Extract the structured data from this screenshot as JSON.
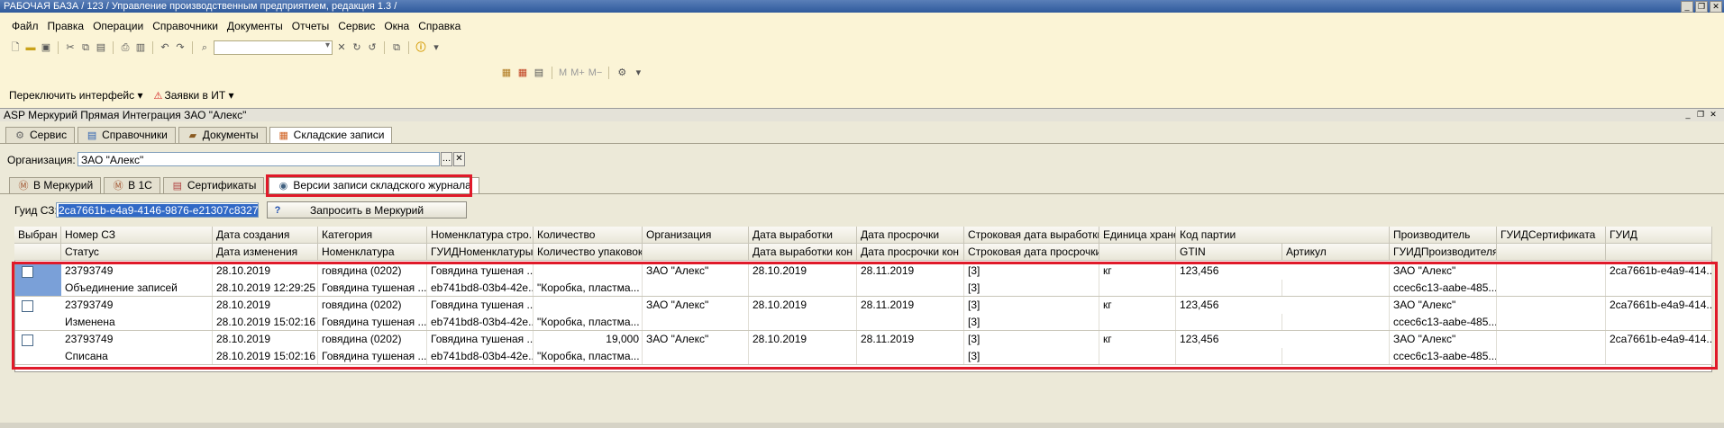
{
  "window": {
    "title": "РАБОЧАЯ БАЗА / 123 / Управление производственным предприятием, редакция 1.3 /"
  },
  "menu": [
    "Файл",
    "Правка",
    "Операции",
    "Справочники",
    "Документы",
    "Отчеты",
    "Сервис",
    "Окна",
    "Справка"
  ],
  "toolbar3": {
    "switch_label": "Переключить интерфейс",
    "requests_label": "Заявки в ИТ"
  },
  "subwindow": {
    "title": "ASP Меркурий Прямая Интеграция ЗАО \"Алекс\""
  },
  "main_tabs": [
    "Сервис",
    "Справочники",
    "Документы",
    "Складские записи"
  ],
  "org": {
    "label": "Организация:",
    "value": "ЗАО \"Алекс\""
  },
  "sub_tabs": [
    "В Меркурий",
    "В 1С",
    "Сертификаты",
    "Версии записи складского журнала"
  ],
  "guid": {
    "label": "Гуид СЗ:",
    "value": "2ca7661b-e4a9-4146-9876-e21307c8327f"
  },
  "request_button": "Запросить в Меркурий",
  "grid": {
    "header_top": [
      "Выбран",
      "Номер СЗ",
      "Дата создания",
      "Категория",
      "Номенклатура стро...",
      "Количество",
      "Организация",
      "Дата выработки",
      "Дата просрочки",
      "Строковая дата выработки",
      "Единица хранения",
      "Код партии",
      "Производитель",
      "ГУИДСертификата",
      "ГУИД"
    ],
    "header_bottom": [
      "",
      "Статус",
      "Дата изменения",
      "Номенклатура",
      "ГУИДНоменклатуры",
      "Количество упаковок",
      "",
      "Дата выработки кон",
      "Дата просрочки кон",
      "Строковая дата просрочки",
      "",
      "GTIN",
      "Артикул",
      "ГУИДПроизводителя",
      "",
      ""
    ],
    "rows": [
      {
        "top": [
          "23793749",
          "28.10.2019",
          "говядина (0202)",
          "Говядина тушеная ...",
          "",
          "ЗАО \"Алекс\"",
          "28.10.2019",
          "28.11.2019",
          "[3]",
          "кг",
          "123,456",
          "ЗАО \"Алекс\"",
          "",
          "2ca7661b-e4a9-414..."
        ],
        "bottom": [
          "Объединение записей",
          "28.10.2019 12:29:25",
          "Говядина тушеная ...",
          "eb741bd8-03b4-42e...",
          "\"Коробка, пластма...",
          "",
          "",
          "",
          "[3]",
          "",
          "",
          "",
          "ccec6c13-aabe-485...",
          "",
          ""
        ]
      },
      {
        "top": [
          "23793749",
          "28.10.2019",
          "говядина (0202)",
          "Говядина тушеная ...",
          "",
          "ЗАО \"Алекс\"",
          "28.10.2019",
          "28.11.2019",
          "[3]",
          "кг",
          "123,456",
          "ЗАО \"Алекс\"",
          "",
          "2ca7661b-e4a9-414..."
        ],
        "bottom": [
          "Изменена",
          "28.10.2019 15:02:16",
          "Говядина тушеная ...",
          "eb741bd8-03b4-42e...",
          "\"Коробка, пластма...",
          "",
          "",
          "",
          "[3]",
          "",
          "",
          "",
          "ccec6c13-aabe-485...",
          "",
          ""
        ]
      },
      {
        "top": [
          "23793749",
          "28.10.2019",
          "говядина (0202)",
          "Говядина тушеная ...",
          "19,000",
          "ЗАО \"Алекс\"",
          "28.10.2019",
          "28.11.2019",
          "[3]",
          "кг",
          "123,456",
          "ЗАО \"Алекс\"",
          "",
          "2ca7661b-e4a9-414..."
        ],
        "bottom": [
          "Списана",
          "28.10.2019 15:02:16",
          "Говядина тушеная ...",
          "eb741bd8-03b4-42e...",
          "\"Коробка, пластма...",
          "",
          "",
          "",
          "[3]",
          "",
          "",
          "",
          "ccec6c13-aabe-485...",
          "",
          ""
        ]
      }
    ]
  },
  "colors": {
    "highlight_red": "#e01a2a",
    "selection_blue": "#3169c6"
  }
}
